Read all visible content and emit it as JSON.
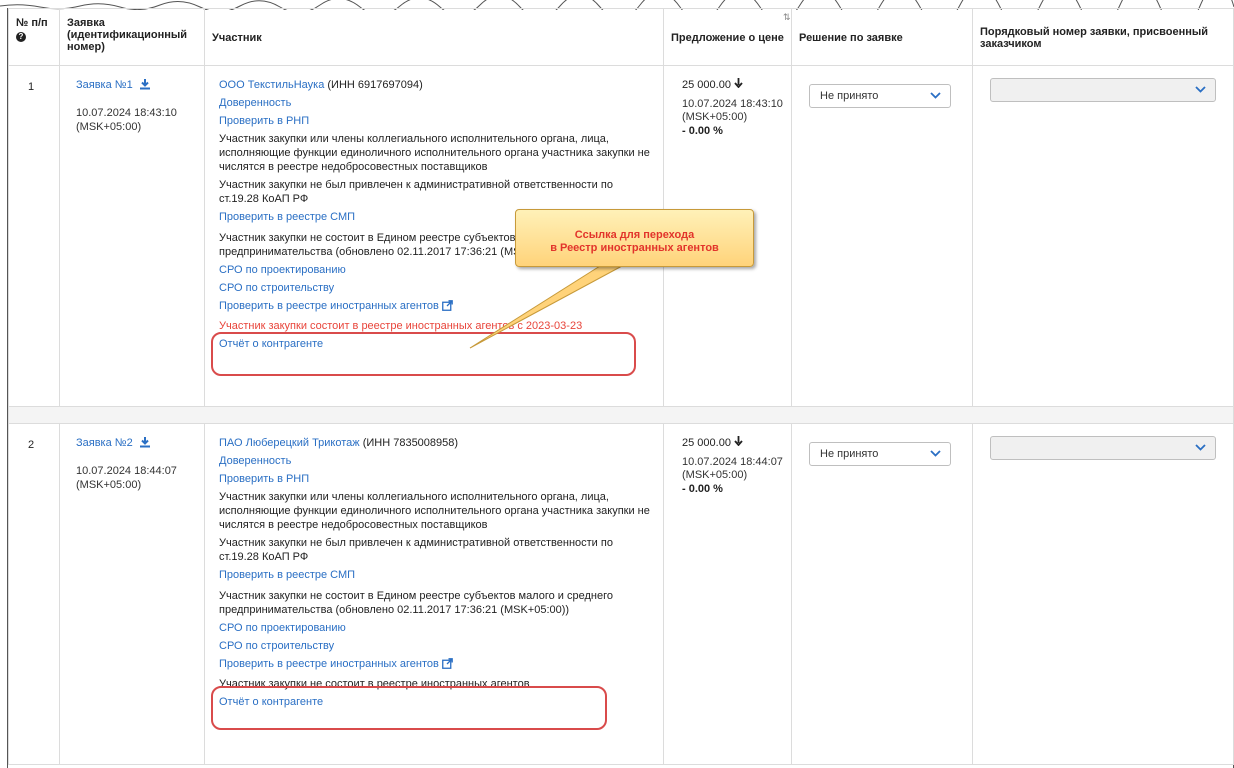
{
  "headers": {
    "num": "№ п/п",
    "application": "Заявка (идентификационный номер)",
    "participant": "Участник",
    "price": "Предложение о цене",
    "decision": "Решение по заявке",
    "order": "Порядковый номер заявки, присвоенный заказчиком"
  },
  "rows": [
    {
      "num": "1",
      "app_link": "Заявка №1",
      "app_date": "10.07.2024 18:43:10 (MSK+05:00)",
      "company_link": "ООО ТекстильНаука",
      "inn": " (ИНН 6917697094)",
      "proxy": "Доверенность",
      "check_rnp": "Проверить в РНП",
      "rnp_text": "Участник закупки или члены коллегиального исполнительного органа, лица, исполняющие функции единоличного исполнительного органа участника закупки не числятся в реестре недобросовестных поставщиков",
      "koap_text": "Участник закупки не был привлечен к административной ответственности по ст.19.28 КоАП РФ",
      "check_smp": "Проверить в реестре СМП",
      "smp_text": "Участник закупки не состоит в Едином реестре субъектов малого и среднего предпринимательства (обновлено 02.11.2017 17:36:21 (MSK+05:00))",
      "sro_design": "СРО по проектированию",
      "sro_build": "СРО по строительству",
      "check_agents": "Проверить в реестре иностранных агентов",
      "agents_text": "Участник закупки состоит в реестре иностранных агентов с 2023-03-23",
      "report": "Отчёт о контрагенте",
      "price": "25 000.00",
      "price_date": "10.07.2024 18:43:10 (MSK+05:00)",
      "pct": "- 0.00 %",
      "decision": "Не принято"
    },
    {
      "num": "2",
      "app_link": "Заявка №2",
      "app_date": "10.07.2024 18:44:07 (MSK+05:00)",
      "company_link": "ПАО Люберецкий Трикотаж",
      "inn": " (ИНН 7835008958)",
      "proxy": "Доверенность",
      "check_rnp": "Проверить в РНП",
      "rnp_text": "Участник закупки или члены коллегиального исполнительного органа, лица, исполняющие функции единоличного исполнительного органа участника закупки не числятся в реестре недобросовестных поставщиков",
      "koap_text": "Участник закупки не был привлечен к административной ответственности по ст.19.28 КоАП РФ",
      "check_smp": "Проверить в реестре СМП",
      "smp_text": "Участник закупки не состоит в Едином реестре субъектов малого и среднего предпринимательства (обновлено 02.11.2017 17:36:21 (MSK+05:00))",
      "sro_design": "СРО по проектированию",
      "sro_build": "СРО по строительству",
      "check_agents": "Проверить в реестре иностранных агентов",
      "agents_text": "Участник закупки не состоит в реестре иностранных агентов",
      "report": "Отчёт о контрагенте",
      "price": "25 000.00",
      "price_date": "10.07.2024 18:44:07 (MSK+05:00)",
      "pct": "- 0.00 %",
      "decision": "Не принято"
    }
  ],
  "callout": {
    "line1": "Ссылка для перехода",
    "line2": "в Реестр иностранных агентов"
  },
  "colors": {
    "link": "#2a6fc4",
    "alert": "#e8443a",
    "callout_bg": "#ffd37a",
    "highlight": "#d94b4b"
  }
}
